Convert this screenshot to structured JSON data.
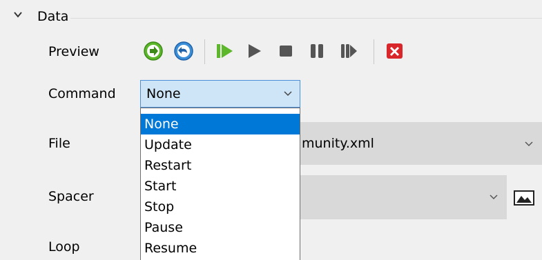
{
  "section": {
    "title": "Data",
    "expanded": true
  },
  "labels": {
    "preview": "Preview",
    "command": "Command",
    "file": "File",
    "spacer": "Spacer",
    "loop": "Loop"
  },
  "toolbar": {
    "buttons": [
      "go-forward-icon",
      "go-back-icon",
      "start-icon",
      "play-icon",
      "stop-icon",
      "pause-icon",
      "resume-icon",
      "close-icon"
    ]
  },
  "command": {
    "value": "None",
    "options": [
      "None",
      "Update",
      "Restart",
      "Start",
      "Stop",
      "Pause",
      "Resume"
    ],
    "selected_index": 0
  },
  "file": {
    "value_visible": "munity.xml"
  },
  "spacer": {
    "value": ""
  },
  "colors": {
    "highlight": "#0078d7",
    "combo_active": "#cde5f7",
    "combo_border": "#4a90d9",
    "green": "#5cb82a",
    "blue": "#3b8ed8",
    "red": "#d9262a"
  }
}
